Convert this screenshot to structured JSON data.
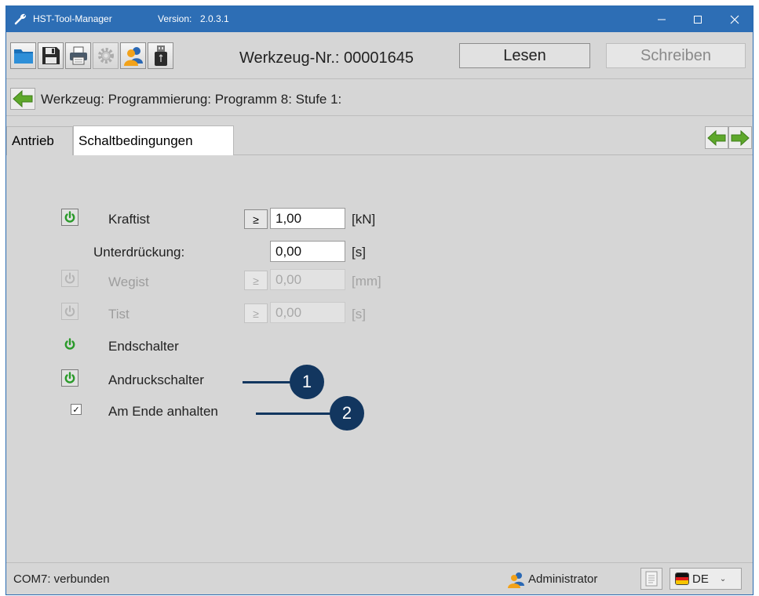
{
  "titlebar": {
    "app_title": "HST-Tool-Manager",
    "version_label": "Version:",
    "version_value": "2.0.3.1",
    "accent_color": "#2d6eb5"
  },
  "toolbar": {
    "buttons": [
      {
        "name": "open",
        "icon": "folder-icon"
      },
      {
        "name": "save",
        "icon": "floppy-disk-icon"
      },
      {
        "name": "print",
        "icon": "printer-icon"
      },
      {
        "name": "settings",
        "icon": "gear-icon",
        "disabled": true
      },
      {
        "name": "user",
        "icon": "user-icon"
      },
      {
        "name": "usb",
        "icon": "usb-device-icon"
      }
    ],
    "werkzeug_nr": "Werkzeug-Nr.: 00001645",
    "lesen_label": "Lesen",
    "schreiben_label": "Schreiben"
  },
  "breadcrumb": {
    "text": "Werkzeug: Programmierung: Programm 8: Stufe 1:"
  },
  "tabs": [
    {
      "label": "Antrieb",
      "active": false
    },
    {
      "label": "Schaltbedingungen",
      "active": true
    }
  ],
  "conditions": {
    "kraftist": {
      "label": "Kraftist",
      "operator": "≥",
      "value": "1,00",
      "unit": "[kN]",
      "enabled": true
    },
    "unterdrueckung": {
      "label": "Unterdrückung:",
      "value": "0,00",
      "unit": "[s]"
    },
    "wegist": {
      "label": "Wegist",
      "operator": "≥",
      "value": "0,00",
      "unit": "[mm]",
      "enabled": false
    },
    "tist": {
      "label": "Tist",
      "operator": "≥",
      "value": "0,00",
      "unit": "[s]",
      "enabled": false
    },
    "endschalter": {
      "label": "Endschalter",
      "enabled": true
    },
    "andruckschalter": {
      "label": "Andruckschalter",
      "enabled": true
    },
    "am_ende_anhalten": {
      "label": "Am Ende anhalten",
      "checked": true,
      "check_mark": "✓"
    }
  },
  "callouts": [
    "1",
    "2"
  ],
  "statusbar": {
    "connection": "COM7: verbunden",
    "user": "Administrator",
    "language": "DE"
  },
  "colors": {
    "power_on": "#2a9a2a",
    "power_off": "#b5b5b5",
    "callout": "#12365f"
  }
}
